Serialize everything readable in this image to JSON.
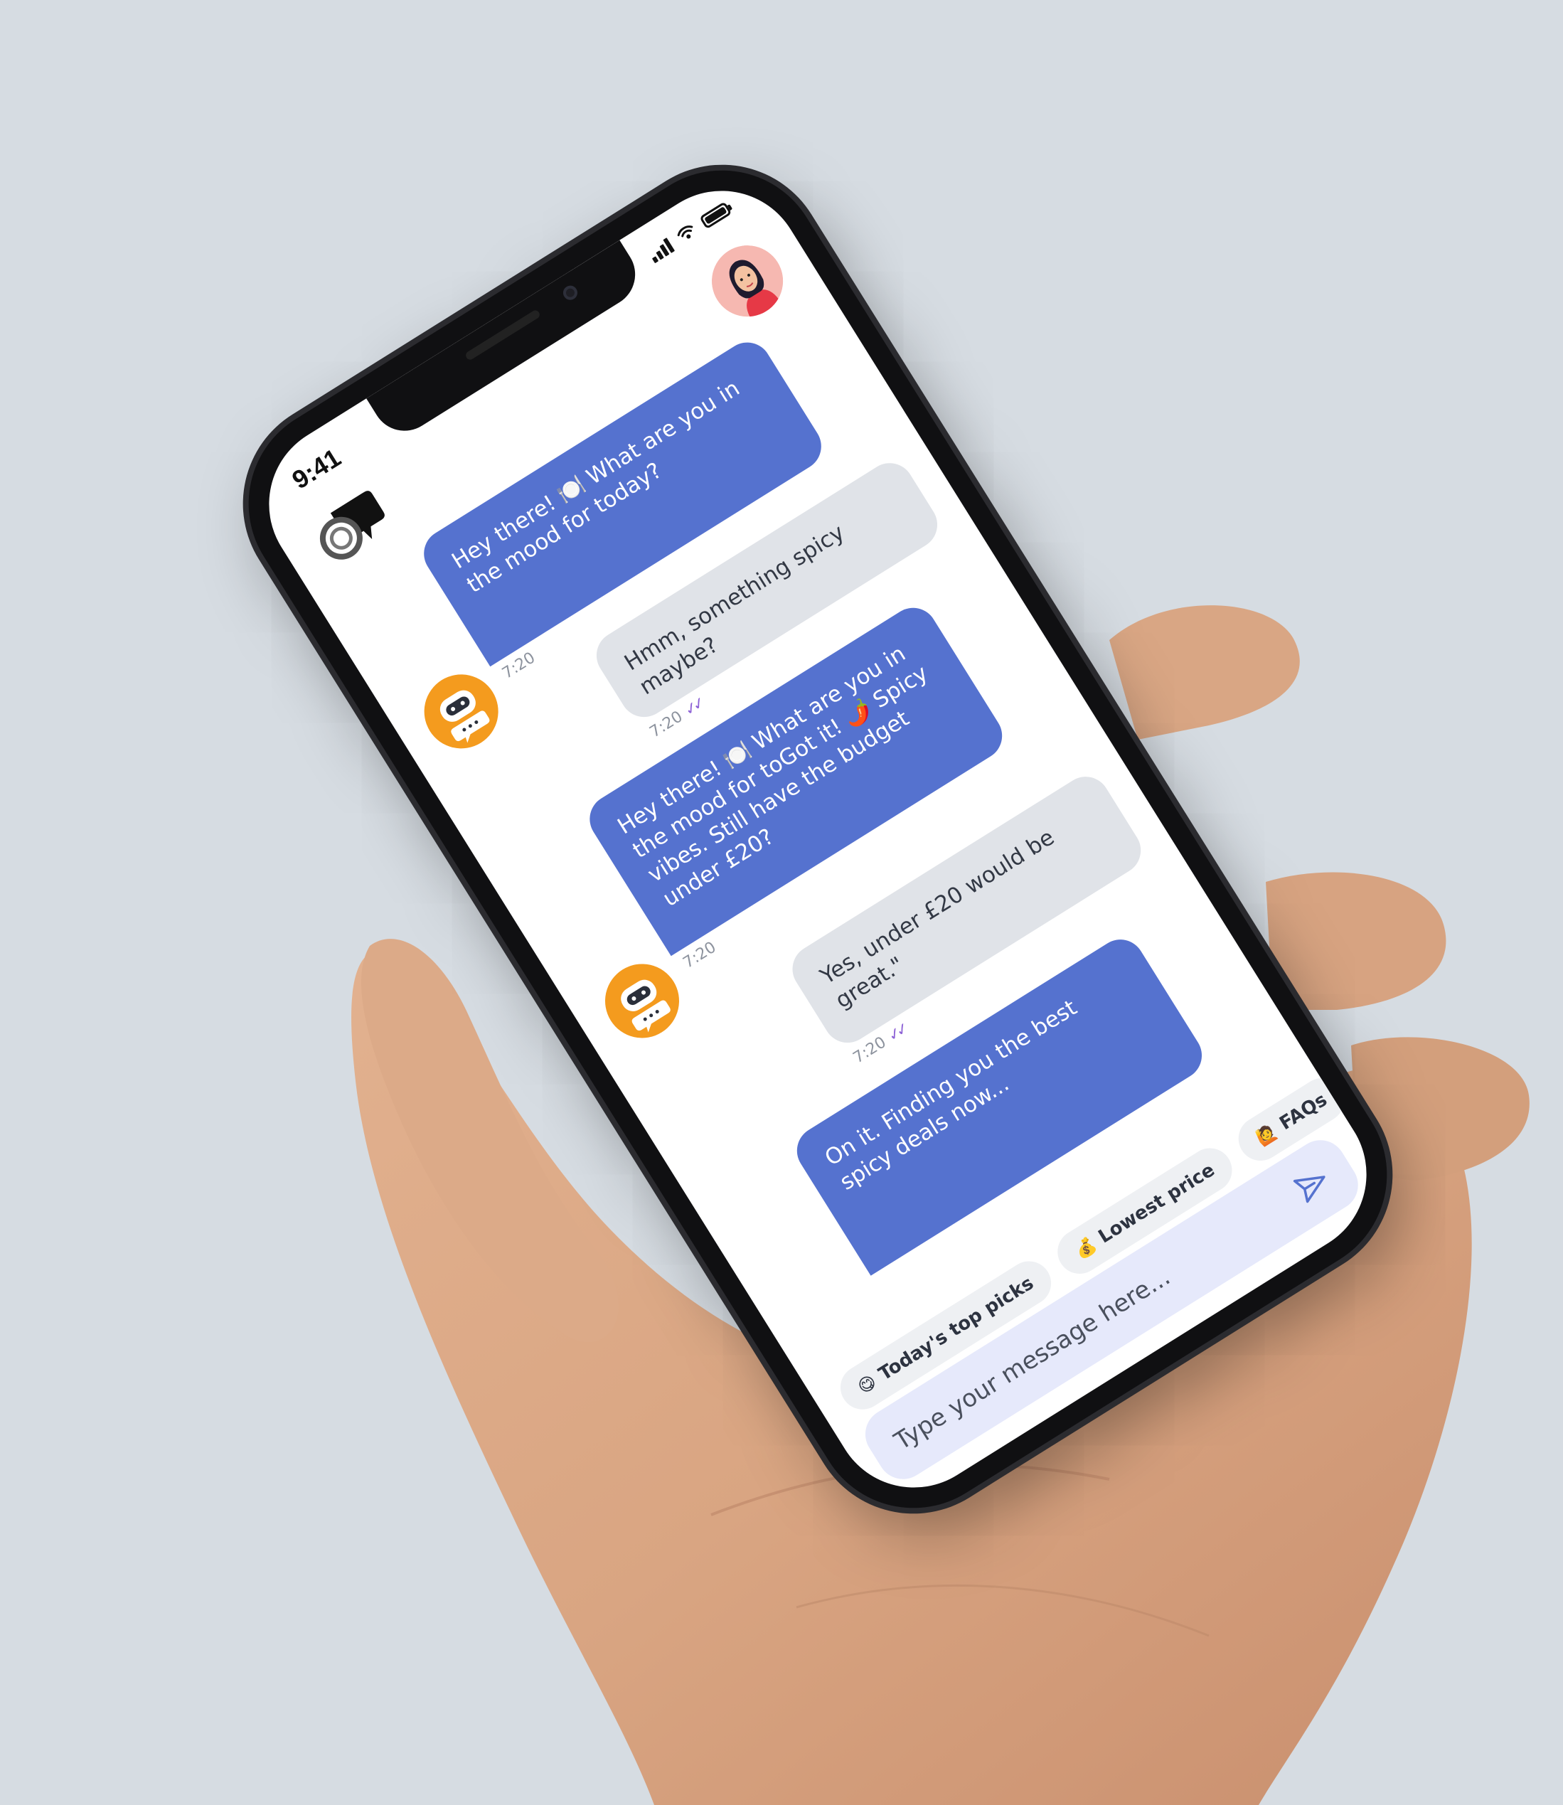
{
  "status_bar": {
    "time": "9:41"
  },
  "header": {
    "logo_icon": "chat-logo-icon",
    "profile_avatar": "user-avatar"
  },
  "messages": [
    {
      "sender": "bot",
      "text": "Hey there! 🍽️ What are you in the mood for today?",
      "time": "7:20"
    },
    {
      "sender": "user",
      "text": "Hmm, something spicy maybe?",
      "time": "7:20"
    },
    {
      "sender": "bot",
      "text": "Hey there! 🍽️ What are you in the mood for toGot it! 🌶️ Spicy vibes. Still have the budget under £20?",
      "time": "7:20"
    },
    {
      "sender": "user",
      "text": "Yes, under £20 would be great.\"",
      "time": "7:20"
    },
    {
      "sender": "bot",
      "text": "On it. Finding you the best spicy deals now...",
      "time": ""
    }
  ],
  "quick_replies": [
    {
      "emoji": "😋",
      "label": "Today's top picks"
    },
    {
      "emoji": "💰",
      "label": "Lowest price"
    },
    {
      "emoji": "🙋",
      "label": "FAQs"
    }
  ],
  "composer": {
    "placeholder": "Type your message here..."
  },
  "colors": {
    "bot_bubble": "#5572cf",
    "user_bubble": "#e0e3e8",
    "accent_orange": "#f49b1e",
    "read_ticks": "#8e63d6",
    "composer_bg": "#e6e9fb"
  },
  "icons": {
    "send": "send-icon",
    "read_receipt": "double-check-icon",
    "bot": "robot-icon"
  }
}
